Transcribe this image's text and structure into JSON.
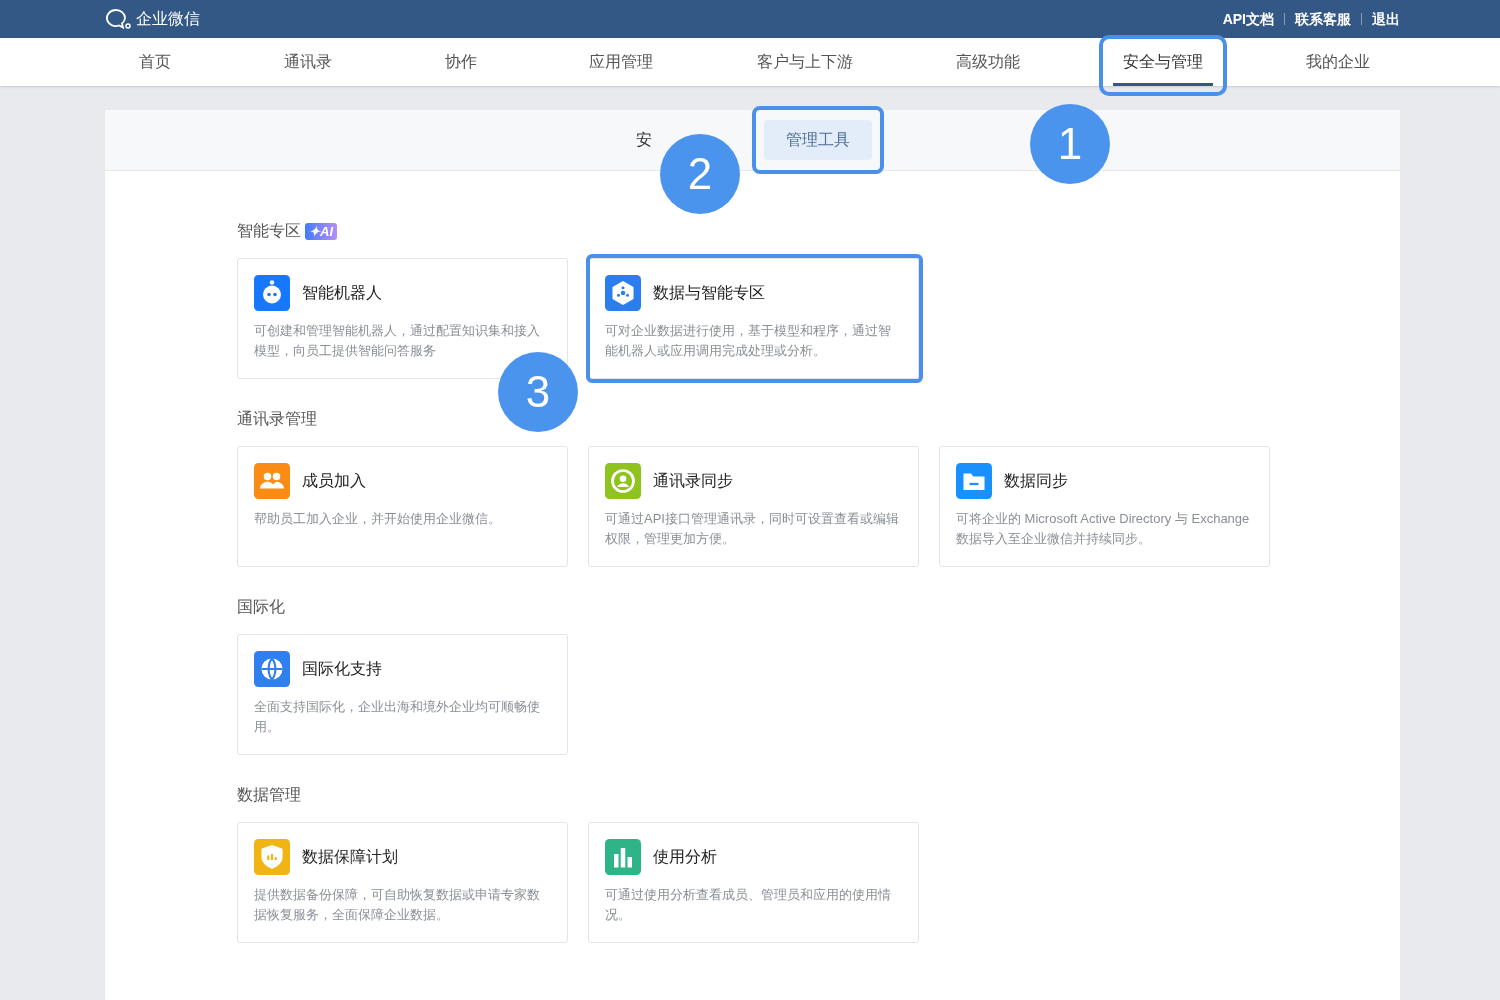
{
  "top_bar": {
    "logo": "企业微信",
    "links": [
      "API文档",
      "联系客服",
      "退出"
    ]
  },
  "nav": [
    {
      "label": "首页",
      "selected": false,
      "highlighted": false
    },
    {
      "label": "通讯录",
      "selected": false,
      "highlighted": false
    },
    {
      "label": "协作",
      "selected": false,
      "highlighted": false
    },
    {
      "label": "应用管理",
      "selected": false,
      "highlighted": false
    },
    {
      "label": "客户与上下游",
      "selected": false,
      "highlighted": false
    },
    {
      "label": "高级功能",
      "selected": false,
      "highlighted": false
    },
    {
      "label": "安全与管理",
      "selected": true,
      "highlighted": true
    },
    {
      "label": "我的企业",
      "selected": false,
      "highlighted": false
    }
  ],
  "sub_tabs": [
    {
      "label": "安",
      "selected": false,
      "highlighted": false
    },
    {
      "label": "管理工具",
      "selected": true,
      "highlighted": true
    }
  ],
  "sections": [
    {
      "title": "智能专区",
      "badge": "✦AI",
      "cards": [
        {
          "kind": "robot",
          "color": "#1677ff",
          "title": "智能机器人",
          "description": "可创建和管理智能机器人，通过配置知识集和接入模型，向员工提供智能问答服务",
          "highlighted": false
        },
        {
          "kind": "hexagon",
          "color": "#2a7ef0",
          "title": "数据与智能专区",
          "description": "可对企业数据进行使用，基于模型和程序，通过智能机器人或应用调用完成处理或分析。",
          "highlighted": true
        }
      ]
    },
    {
      "title": "通讯录管理",
      "cards": [
        {
          "kind": "people",
          "color": "#fa8c16",
          "title": "成员加入",
          "description": "帮助员工加入企业，并开始使用企业微信。",
          "highlighted": false
        },
        {
          "kind": "person",
          "color": "#8fc31f",
          "title": "通讯录同步",
          "description": "可通过API接口管理通讯录，同时可设置查看或编辑权限，管理更加方便。",
          "highlighted": false
        },
        {
          "kind": "folder",
          "color": "#1890ff",
          "title": "数据同步",
          "description": "可将企业的 Microsoft Active Directory 与 Exchange 数据导入至企业微信并持续同步。",
          "highlighted": false
        }
      ]
    },
    {
      "title": "国际化",
      "cards": [
        {
          "kind": "globe",
          "color": "#2f7ff0",
          "title": "国际化支持",
          "description": "全面支持国际化，企业出海和境外企业均可顺畅使用。",
          "highlighted": false
        }
      ]
    },
    {
      "title": "数据管理",
      "cards": [
        {
          "kind": "shield",
          "color": "#f0b414",
          "title": "数据保障计划",
          "description": "提供数据备份保障，可自助恢复数据或申请专家数据恢复服务，全面保障企业数据。",
          "highlighted": false
        },
        {
          "kind": "bars",
          "color": "#2fb487",
          "title": "使用分析",
          "description": "可通过使用分析查看成员、管理员和应用的使用情况。",
          "highlighted": false
        }
      ]
    }
  ],
  "callouts": [
    {
      "label": "1"
    },
    {
      "label": "2"
    },
    {
      "label": "3"
    }
  ]
}
